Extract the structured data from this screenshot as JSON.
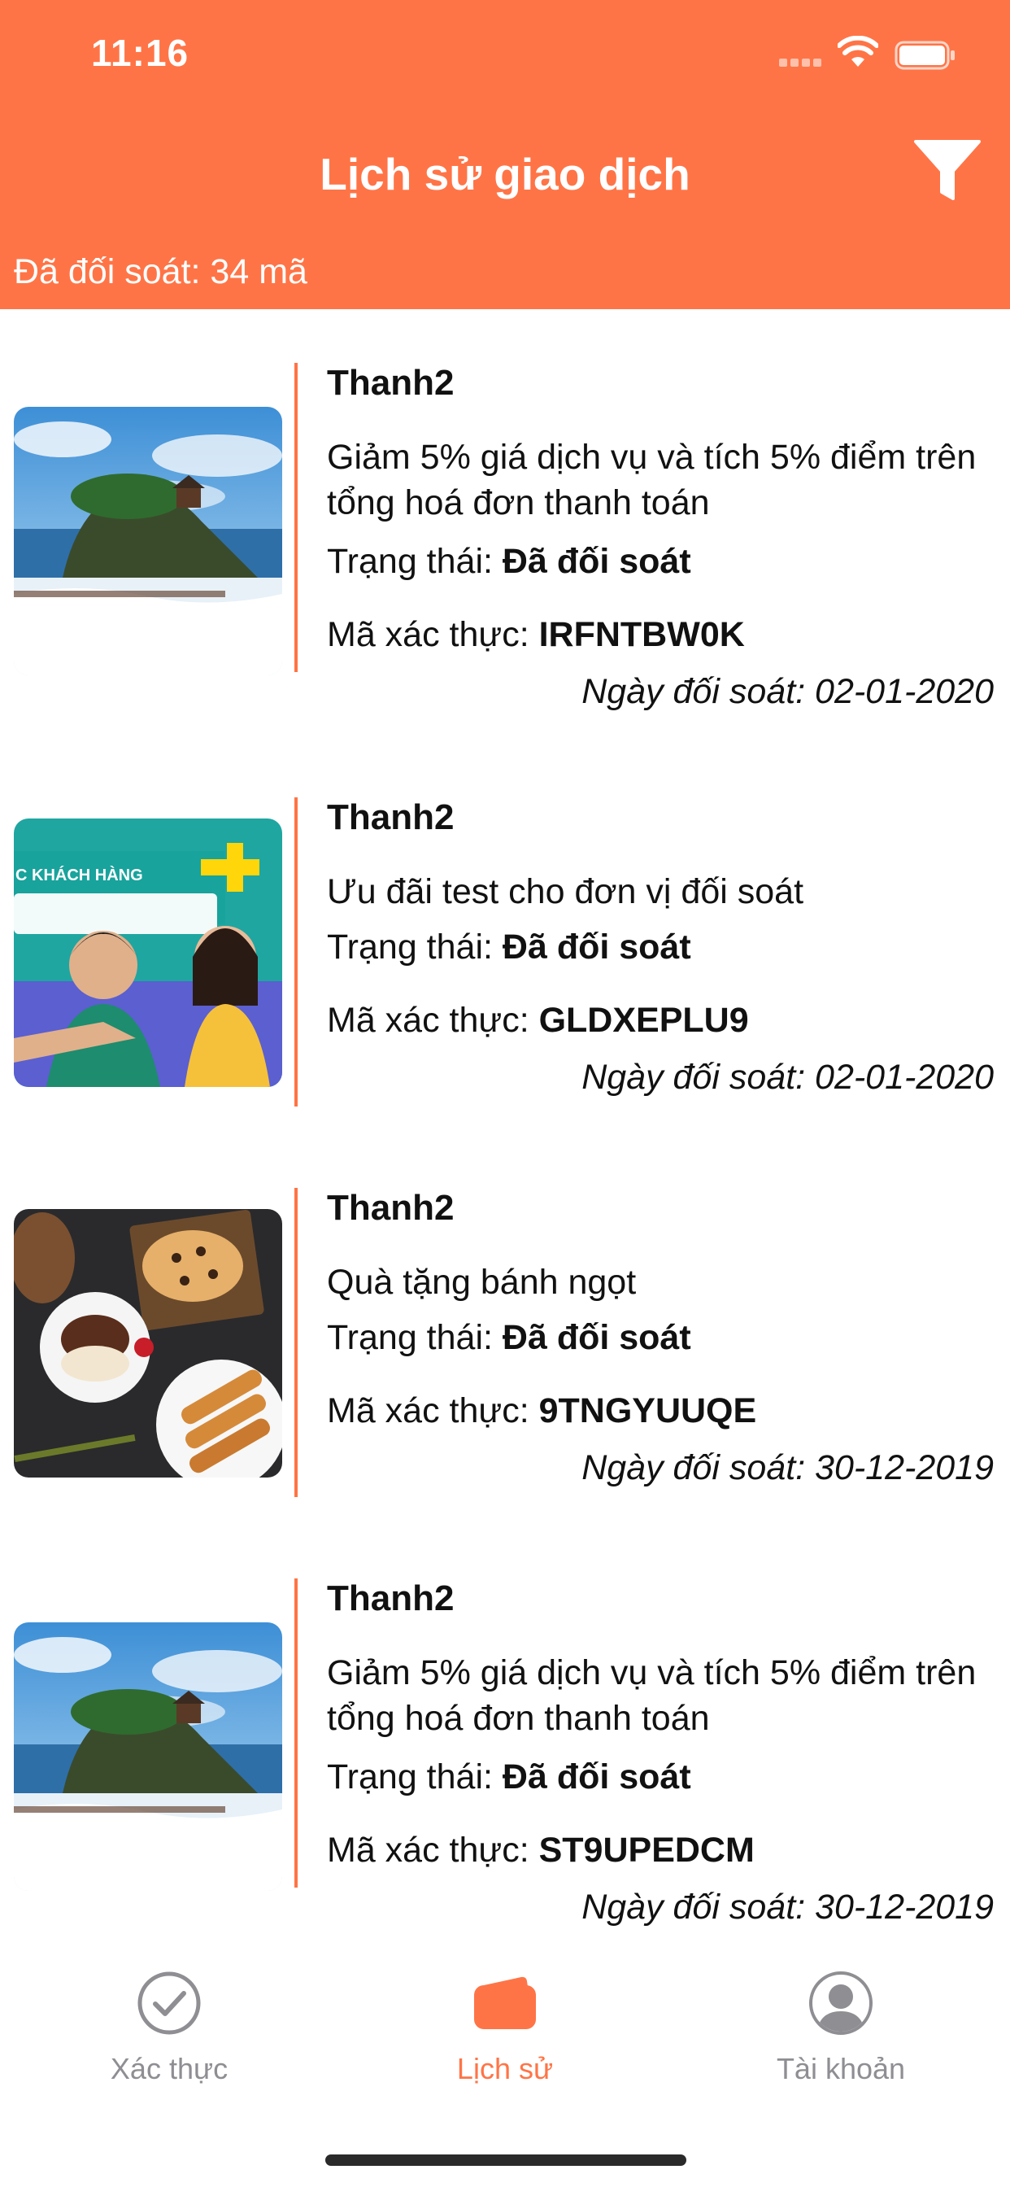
{
  "status_bar": {
    "time": "11:16"
  },
  "header": {
    "title": "Lịch sử giao dịch",
    "filter_icon": "filter-icon",
    "reconciled_count": "Đã đối soát: 34 mã"
  },
  "labels": {
    "status_prefix": "Trạng thái: ",
    "code_prefix": "Mã xác thực: ",
    "date_prefix": "Ngày đối soát: "
  },
  "transactions": [
    {
      "merchant": "Thanh2",
      "offer": "Giảm 5% giá dịch vụ và tích 5% điểm trên tổng hoá đơn thanh toán",
      "status": "Đã đối soát",
      "code": "IRFNTBW0K",
      "date": "02-01-2020",
      "image": "beach-temple-photo"
    },
    {
      "merchant": "Thanh2",
      "offer": "Ưu đãi test cho đơn vị đối soát",
      "status": "Đã đối soát",
      "code": "GLDXEPLU9",
      "date": "02-01-2020",
      "image": "viettel-promo-photo",
      "image_text": "C KHÁCH HÀNG"
    },
    {
      "merchant": "Thanh2",
      "offer": "Quà tặng bánh ngọt",
      "status": "Đã đối soát",
      "code": "9TNGYUUQE",
      "date": "30-12-2019",
      "image": "dessert-photo"
    },
    {
      "merchant": "Thanh2",
      "offer": "Giảm 5% giá dịch vụ và tích 5% điểm trên tổng hoá đơn thanh toán",
      "status": "Đã đối soát",
      "code": "ST9UPEDCM",
      "date": "30-12-2019",
      "image": "beach-temple-photo"
    }
  ],
  "tabbar": {
    "tabs": [
      {
        "label": "Xác thực",
        "icon": "check-circle-icon",
        "active": false
      },
      {
        "label": "Lịch sử",
        "icon": "wallet-icon",
        "active": true
      },
      {
        "label": "Tài khoản",
        "icon": "user-circle-icon",
        "active": false
      }
    ]
  },
  "colors": {
    "brand": "#ff7446",
    "inactive_tab": "#8e8e93"
  }
}
